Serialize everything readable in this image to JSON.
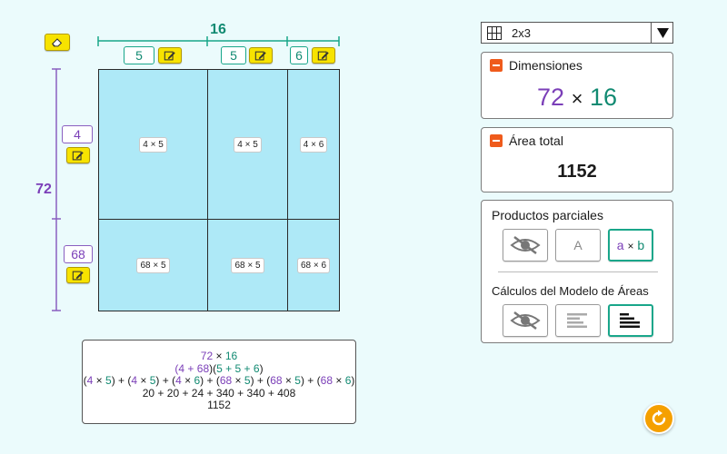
{
  "dimensions_width": {
    "total": "16",
    "parts": [
      "5",
      "5",
      "6"
    ]
  },
  "dimensions_height": {
    "total": "72",
    "parts": [
      "4",
      "68"
    ]
  },
  "cells": [
    [
      "4 × 5",
      "4 × 5",
      "4 × 6"
    ],
    [
      "68 × 5",
      "68 × 5",
      "68 × 6"
    ]
  ],
  "grid_select": {
    "value": "2x3"
  },
  "dim_panel": {
    "title": "Dimensiones",
    "a": "72",
    "times": "×",
    "b": "16"
  },
  "area_panel": {
    "title": "Área total",
    "value": "1152"
  },
  "options_panel": {
    "partial_title": "Productos parciales",
    "letter_a": "A",
    "axb_a": "a",
    "axb_x": "×",
    "axb_b": "b",
    "calc_title": "Cálculos del Modelo de Áreas"
  },
  "formula": {
    "line1": {
      "a": "72",
      "x": " × ",
      "b": "16"
    },
    "line2": {
      "open1": "(4 + ",
      "a2": "68",
      "mid": ")(",
      "b1": "5",
      "p1": " + ",
      "b2": "5",
      "p2": " + ",
      "b3": "6",
      "close": ")"
    },
    "line3": {
      "t1": {
        "a": "4",
        "b": "5"
      },
      "t2": {
        "a": "4",
        "b": "5"
      },
      "t3": {
        "a": "4",
        "b": "6"
      },
      "t4": {
        "a": "68",
        "b": "5"
      },
      "t5": {
        "a": "68",
        "b": "5"
      },
      "t6": {
        "a": "68",
        "b": "6"
      }
    },
    "line4": "20 + 20 + 24 + 340 + 340 + 408",
    "line5": "1152"
  },
  "colors": {
    "purple": "#7b3fb8",
    "green": "#118a72",
    "cell": "#aee9f7",
    "accent": "#ef5b1c",
    "yellow": "#f7e300"
  },
  "icons": {
    "eraser": "eraser-icon",
    "edit": "edit-icon",
    "grid": "grid-icon",
    "reset": "reset-icon",
    "hide": "eye-slash-icon"
  }
}
